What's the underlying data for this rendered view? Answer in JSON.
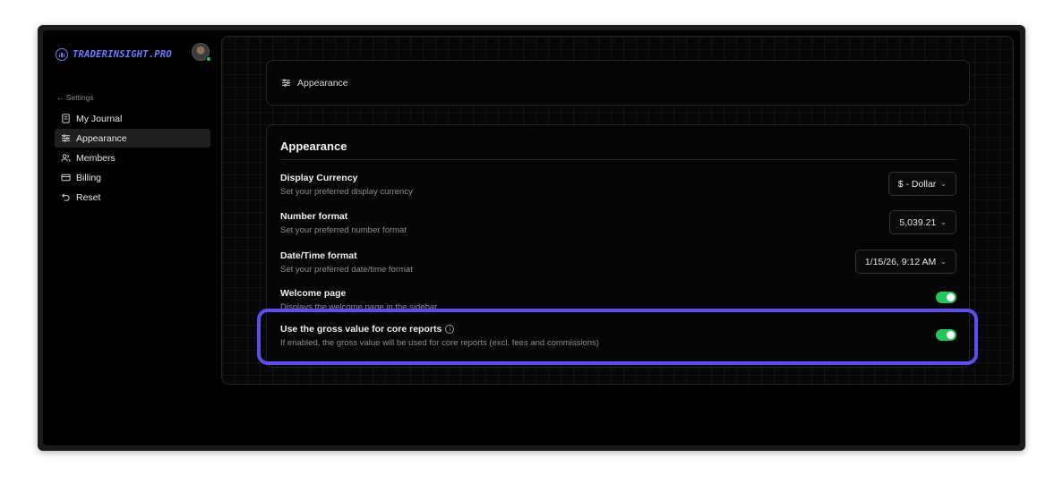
{
  "brand": {
    "name": "TRADERINSIGHT.PRO",
    "accent": "#6b7cff"
  },
  "sidebar": {
    "back_label": "← Settings",
    "items": [
      {
        "label": "My Journal",
        "icon": "journal-icon"
      },
      {
        "label": "Appearance",
        "icon": "sliders-icon",
        "active": true
      },
      {
        "label": "Members",
        "icon": "members-icon"
      },
      {
        "label": "Billing",
        "icon": "card-icon"
      },
      {
        "label": "Reset",
        "icon": "reset-icon"
      }
    ]
  },
  "header_card": {
    "label": "Appearance",
    "icon": "sliders-icon"
  },
  "appearance": {
    "title": "Appearance",
    "currency": {
      "label": "Display Currency",
      "desc": "Set your preferred display currency",
      "value": "$ - Dollar"
    },
    "number": {
      "label": "Number format",
      "desc": "Set your preferred number format",
      "value": "5,039.21"
    },
    "datetime": {
      "label": "Date/Time format",
      "desc": "Set your preferred date/time format",
      "value": "1/15/26, 9:12 AM"
    },
    "welcome": {
      "label": "Welcome page",
      "desc": "Displays the welcome page in the sidebar",
      "enabled": true
    },
    "gross": {
      "label": "Use the gross value for core reports",
      "desc": "If enabled, the gross value will be used for core reports (excl. fees and commissions)",
      "enabled": true
    }
  },
  "colors": {
    "toggle_on": "#22c55e",
    "highlight": "#5b4df0"
  }
}
